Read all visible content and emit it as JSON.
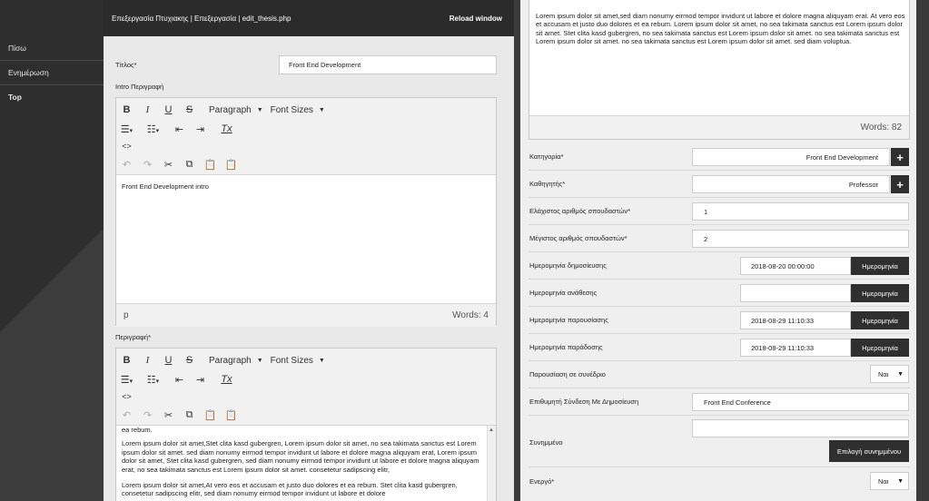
{
  "sidebar": {
    "items": [
      {
        "label": "Πίσω"
      },
      {
        "label": "Ενημέρωση"
      },
      {
        "label": "Top"
      }
    ]
  },
  "header": {
    "title": "Επεξεργασία Πτυχιακης | Επεξεργασία | edit_thesis.php",
    "reload": "Reload window"
  },
  "form_left": {
    "title_label": "Τίτλος*",
    "title_value": "Front End Development",
    "intro_label": "Intro Περιγραφή",
    "intro_text": "Front End Development intro",
    "intro_path": "p",
    "intro_words": "Words: 4",
    "desc_label": "Περιγραφή*",
    "desc_paragraphs": [
      "ea rebum.",
      "Lorem ipsum dolor sit amet,Stet clita kasd gubergren, Lorem ipsum dolor sit amet, no sea takimata sanctus est Lorem ipsum dolor sit amet. sed diam nonumy eirmod tempor invidunt ut labore et dolore magna aliquyam erat, Lorem ipsum dolor sit amet, Stet clita kasd gubergren, sed diam nonumy eirmod tempor invidunt ut labore et dolore magna aliquyam erat, no sea takimata sanctus est Lorem ipsum dolor sit amet. consetetur sadipscing elitr,",
      "Lorem ipsum dolor sit amet,At vero eos et accusam et justo duo dolores et ea rebum. Stet clita kasd gubergren, consetetur sadipscing elitr, sed diam nonumy eirmod tempor invidunt ut labore et dolore"
    ]
  },
  "toolbar": {
    "bold": "B",
    "italic": "I",
    "underline": "U",
    "strike": "S",
    "paragraph": "Paragraph",
    "font_sizes": "Font Sizes",
    "code": "<>",
    "clear_format": "Tx"
  },
  "form_right": {
    "en_label": "EN",
    "en_text": "Lorem ipsum dolor sit amet,sed diam nonumy eirmod tempor invidunt ut labore et dolore magna aliquyam erat. At vero eos et accusam et justo duo dolores et ea rebum. Lorem ipsum dolor sit amet, no sea takimata sanctus est Lorem ipsum dolor sit amet. Stet clita kasd gubergren, no sea takimata sanctus est Lorem ipsum dolor sit amet. no sea takimata sanctus est Lorem ipsum dolor sit amet. no sea takimata sanctus est Lorem ipsum dolor sit amet. sed diam voluptua.",
    "en_words": "Words: 82",
    "category_label": "Κατηγορία*",
    "category_value": "Front End Development",
    "professor_label": "Καθηγητής*",
    "professor_value": "Professor",
    "min_students_label": "Ελάχιστος αριθμός σπουδαστών*",
    "min_students_value": "1",
    "max_students_label": "Μέγιστος αριθμός σπουδαστών*",
    "max_students_value": "2",
    "publish_date_label": "Ημερομηνία δημοσίευσης",
    "publish_date_value": "2018-08-20 00:00:00",
    "assign_date_label": "Ημερομηνία ανάθεσης",
    "assign_date_value": "",
    "presentation_date_label": "Ημερομηνία παρουσίασης",
    "presentation_date_value": "2018-08-29 11:10:33",
    "delivery_date_label": "Ημερομηνία παράδοσης",
    "delivery_date_value": "2018-08-29 11:10:33",
    "date_button": "Ημερομηνία",
    "conference_label": "Παρουσίαση σε συνέδριο",
    "conference_value": "Ναι",
    "desired_link_label": "Επιθυμητή Σύνδεση Με Δημοσίευση",
    "desired_link_value": "Front End Conference",
    "attachment_label": "Συνημμένο",
    "attachment_button": "Επιλογή συνημμένου",
    "active_label": "Ενεργό*",
    "active_value": "Ναι"
  }
}
